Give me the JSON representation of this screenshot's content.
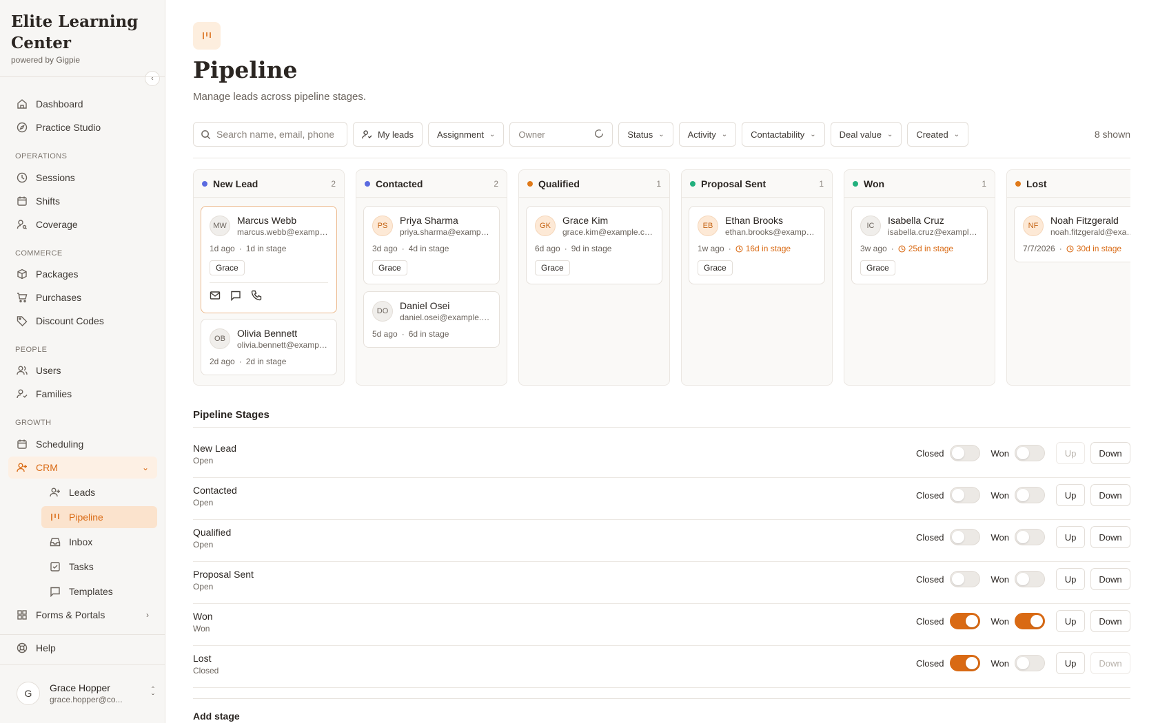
{
  "sidebar": {
    "brand_title": "Elite Learning Center",
    "brand_sub": "powered by Gigpie",
    "items": {
      "dashboard": "Dashboard",
      "practice_studio": "Practice Studio",
      "sessions": "Sessions",
      "shifts": "Shifts",
      "coverage": "Coverage",
      "packages": "Packages",
      "purchases": "Purchases",
      "discount_codes": "Discount Codes",
      "users": "Users",
      "families": "Families",
      "scheduling": "Scheduling",
      "crm": "CRM",
      "leads": "Leads",
      "pipeline": "Pipeline",
      "inbox": "Inbox",
      "tasks": "Tasks",
      "templates": "Templates",
      "forms_portals": "Forms & Portals",
      "help": "Help"
    },
    "sections": {
      "operations": "OPERATIONS",
      "commerce": "COMMERCE",
      "people": "PEOPLE",
      "growth": "GROWTH"
    },
    "user": {
      "initial": "G",
      "name": "Grace Hopper",
      "email": "grace.hopper@co..."
    }
  },
  "header": {
    "title": "Pipeline",
    "subtitle": "Manage leads across pipeline stages."
  },
  "filters": {
    "search_placeholder": "Search name, email, phone",
    "my_leads": "My leads",
    "assignment": "Assignment",
    "owner": "Owner",
    "status": "Status",
    "activity": "Activity",
    "contactability": "Contactability",
    "deal_value": "Deal value",
    "created": "Created",
    "shown": "8 shown"
  },
  "board": {
    "columns": [
      {
        "name": "New Lead",
        "count": "2",
        "color": "#5b6be0",
        "cards": [
          {
            "initials": "MW",
            "name": "Marcus Webb",
            "email": "marcus.webb@example.com",
            "age": "1d ago",
            "stage_time": "1d in stage",
            "owner": "Grace"
          },
          {
            "initials": "OB",
            "name": "Olivia Bennett",
            "email": "olivia.bennett@example.com",
            "age": "2d ago",
            "stage_time": "2d in stage"
          }
        ]
      },
      {
        "name": "Contacted",
        "count": "2",
        "color": "#5b6be0",
        "cards": [
          {
            "initials": "PS",
            "name": "Priya Sharma",
            "email": "priya.sharma@example.com",
            "age": "3d ago",
            "stage_time": "4d in stage",
            "owner": "Grace"
          },
          {
            "initials": "DO",
            "name": "Daniel Osei",
            "email": "daniel.osei@example.com",
            "age": "5d ago",
            "stage_time": "6d in stage"
          }
        ]
      },
      {
        "name": "Qualified",
        "count": "1",
        "color": "#e07a1a",
        "cards": [
          {
            "initials": "GK",
            "name": "Grace Kim",
            "email": "grace.kim@example.com",
            "age": "6d ago",
            "stage_time": "9d in stage",
            "owner": "Grace"
          }
        ]
      },
      {
        "name": "Proposal Sent",
        "count": "1",
        "color": "#22b07d",
        "cards": [
          {
            "initials": "EB",
            "name": "Ethan Brooks",
            "email": "ethan.brooks@example.com",
            "age": "1w ago",
            "stage_time": "16d in stage",
            "owner": "Grace"
          }
        ]
      },
      {
        "name": "Won",
        "count": "1",
        "color": "#22b07d",
        "cards": [
          {
            "initials": "IC",
            "name": "Isabella Cruz",
            "email": "isabella.cruz@example.com",
            "age": "3w ago",
            "stage_time": "25d in stage",
            "owner": "Grace"
          }
        ]
      },
      {
        "name": "Lost",
        "count": "",
        "color": "#e07a1a",
        "cards": [
          {
            "initials": "NF",
            "name": "Noah Fitzgerald",
            "email": "noah.fitzgerald@example.com",
            "age": "7/7/2026",
            "stage_time": "30d in stage"
          }
        ]
      }
    ]
  },
  "stages": {
    "title": "Pipeline Stages",
    "closed_label": "Closed",
    "won_label": "Won",
    "up_label": "Up",
    "down_label": "Down",
    "rows": [
      {
        "name": "New Lead",
        "state": "Open",
        "closed": false,
        "won": false
      },
      {
        "name": "Contacted",
        "state": "Open",
        "closed": false,
        "won": false
      },
      {
        "name": "Qualified",
        "state": "Open",
        "closed": false,
        "won": false
      },
      {
        "name": "Proposal Sent",
        "state": "Open",
        "closed": false,
        "won": false
      },
      {
        "name": "Won",
        "state": "Won",
        "closed": true,
        "won": true
      },
      {
        "name": "Lost",
        "state": "Closed",
        "closed": true,
        "won": false
      }
    ],
    "add_stage": "Add stage"
  },
  "colors": {
    "accent": "#d96a14",
    "accent_light": "#fbe3cd"
  }
}
